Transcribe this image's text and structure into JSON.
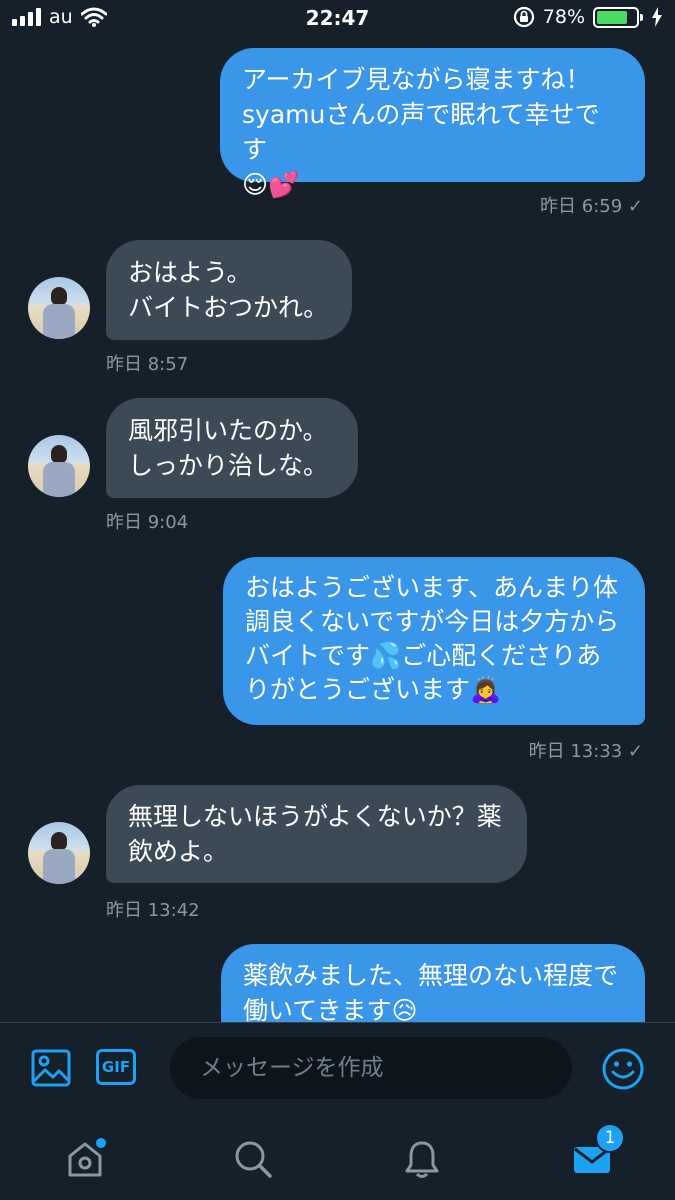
{
  "status_bar": {
    "carrier": "au",
    "time": "22:47",
    "battery_percent": "78%",
    "battery_level": 0.78,
    "icons": [
      "signal-icon",
      "wifi-icon",
      "rotation-lock-icon",
      "battery-icon",
      "charging-icon"
    ]
  },
  "messages": [
    {
      "side": "sent",
      "text": "アーカイブ見ながら寝ますね！\nsyamuさんの声で眠れて幸せです\n😌💕",
      "meta": "昨日 6:59 ✓"
    },
    {
      "side": "received",
      "text": "おはよう。\nバイトおつかれ。",
      "meta": "昨日 8:57"
    },
    {
      "side": "received",
      "text": "風邪引いたのか。\nしっかり治しな。",
      "meta": "昨日 9:04"
    },
    {
      "side": "sent",
      "text": "おはようございます、あんまり体\n調良くないですが今日は夕方から\nバイトです💦ご心配くださりあ\nりがとうございます🙇‍♀️",
      "meta": "昨日 13:33 ✓"
    },
    {
      "side": "received",
      "text": "無理しないほうがよくないか？薬\n飲めよ。",
      "meta": "昨日 13:42"
    },
    {
      "side": "sent",
      "text": "薬飲みました、無理のない程度で\n働いてきます😥",
      "meta": ""
    }
  ],
  "composer": {
    "placeholder": "メッセージを作成",
    "gif_label": "GIF"
  },
  "bottom_nav": {
    "items": [
      "home",
      "search",
      "notifications",
      "messages"
    ],
    "messages_badge": "1",
    "accent_color": "#1da1f2"
  }
}
